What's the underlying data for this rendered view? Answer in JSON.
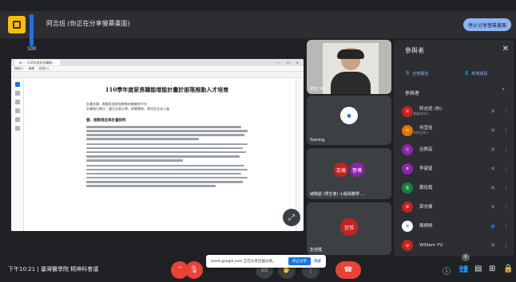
{
  "topbar": {
    "present_title": "阿吉班 (你正在分享螢幕畫面)",
    "stop_button": "停止分享螢幕畫面"
  },
  "zoom": "100",
  "screen": {
    "tab_label": "⊞ ··· 110年度家長職能…",
    "window_buttons": [
      "—",
      "☐",
      "✕"
    ],
    "menu": [
      "檔案(F)",
      "編輯",
      "檢視(V)"
    ],
    "doc_title": "110學年度家長職能增能計畫於部落推動人才培育",
    "doc_meta": [
      "計畫名稱：推動家長參與教育的機會與平台",
      "計畫執行單位：國立台東大學，附屬學校，原住民文化人員"
    ],
    "section_head": "壹、推動理念與計畫說明",
    "collapse_icon": "⤢"
  },
  "tiles": [
    {
      "name": "阿吉 YU",
      "kind": "camera"
    },
    {
      "name": "Yuming",
      "kind": "avatar"
    },
    {
      "name": "總務處 (學生會) 小組與教學 …",
      "kind": "group",
      "badges": [
        "志倫",
        "督導"
      ]
    },
    {
      "name": "彭佳霞",
      "kind": "group",
      "badges": [
        "宜恬"
      ]
    }
  ],
  "panel": {
    "title": "參與者",
    "mute_all": "全部靜音",
    "add": "新增成員",
    "section": "參與者",
    "participants": [
      {
        "short": "阿",
        "name": "阿吉班 (你)",
        "sub": "會議主持人",
        "color": "#c5221f",
        "mic": "✕"
      },
      {
        "short": "何",
        "name": "何宜恬",
        "sub": "共同主持人",
        "color": "#e37400",
        "mic": "✕"
      },
      {
        "short": "呂",
        "name": "呂佩芸",
        "sub": "",
        "color": "#8e24aa",
        "mic": "✕"
      },
      {
        "short": "李",
        "name": "李姿瑩",
        "sub": "",
        "color": "#8e24aa",
        "mic": "✕"
      },
      {
        "short": "蕭",
        "name": "蕭佳霞",
        "sub": "",
        "color": "#188038",
        "mic": "✕"
      },
      {
        "short": "郭",
        "name": "郭志倫",
        "sub": "",
        "color": "#c5221f",
        "mic": "✕"
      },
      {
        "short": "陳",
        "name": "陳婷婷",
        "sub": "",
        "color": "#ffffff",
        "mic": "◉"
      },
      {
        "short": "W",
        "name": "William YU",
        "sub": "",
        "color": "#c5221f",
        "mic": "✕"
      }
    ]
  },
  "bottom": {
    "clock": "下午10:21 | 臺灣醫學院 精神科會議",
    "snackbar_text": "meet.google.com 正在分享這個分頁。",
    "snackbar_stop": "停止分享",
    "snackbar_hide": "隱藏",
    "participant_count": "8"
  }
}
